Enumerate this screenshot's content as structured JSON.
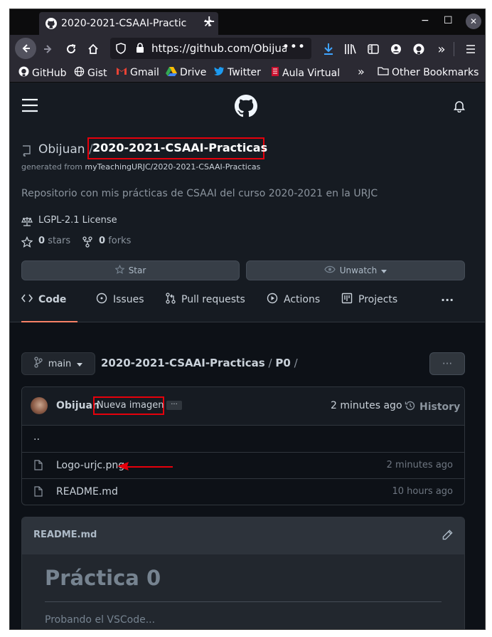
{
  "browser": {
    "tab_title": "2020-2021-CSAAI-Practic",
    "tab_close": "✕",
    "new_tab": "+",
    "url": "https://github.com/Obijuan/",
    "url_menu": "•••",
    "window_controls": {
      "minimize": "−",
      "maximize": "☐",
      "close": "✕"
    }
  },
  "bookmarks": [
    {
      "label": "GitHub"
    },
    {
      "label": "Gist"
    },
    {
      "label": "Gmail"
    },
    {
      "label": "Drive"
    },
    {
      "label": "Twitter"
    },
    {
      "label": "Aula Virtual"
    }
  ],
  "other_bookmarks": "Other Bookmarks",
  "repo": {
    "owner": "Obijuan",
    "separator": "/",
    "name": "2020-2021-CSAAI-Practicas",
    "generated_prefix": "generated from",
    "template": "myTeachingURJC/2020-2021-CSAAI-Practicas",
    "description": "Repositorio con mis prácticas de CSAAI del curso 2020-2021 en la URJC",
    "license": "LGPL-2.1 License",
    "stars_count": "0",
    "stars_label": "stars",
    "forks_count": "0",
    "forks_label": "forks",
    "star_button": "Star",
    "watch_button": "Unwatch"
  },
  "tabs": [
    {
      "label": "Code"
    },
    {
      "label": "Issues"
    },
    {
      "label": "Pull requests"
    },
    {
      "label": "Actions"
    },
    {
      "label": "Projects"
    }
  ],
  "tabs_more": "···",
  "browser_view": {
    "branch": "main",
    "path_repo": "2020-2021-CSAAI-Practicas",
    "path_sep": "/",
    "path_folder": "P0",
    "path_tail": "/",
    "more_button": "···"
  },
  "commit": {
    "author": "Obijuan",
    "message": "Nueva imagen",
    "ellipsis": "···",
    "time": "2 minutes ago",
    "history_label": "History"
  },
  "files": [
    {
      "name": "..",
      "time": ""
    },
    {
      "name": "Logo-urjc.png",
      "time": "2 minutes ago"
    },
    {
      "name": "README.md",
      "time": "10 hours ago"
    }
  ],
  "readme": {
    "filename": "README.md",
    "heading": "Práctica 0",
    "body": "Probando el VSCode..."
  },
  "colors": {
    "highlight_red": "#e6000b",
    "active_tab_underline": "#f78166",
    "page_bg": "#0d1117",
    "header_bg": "#161b22"
  }
}
